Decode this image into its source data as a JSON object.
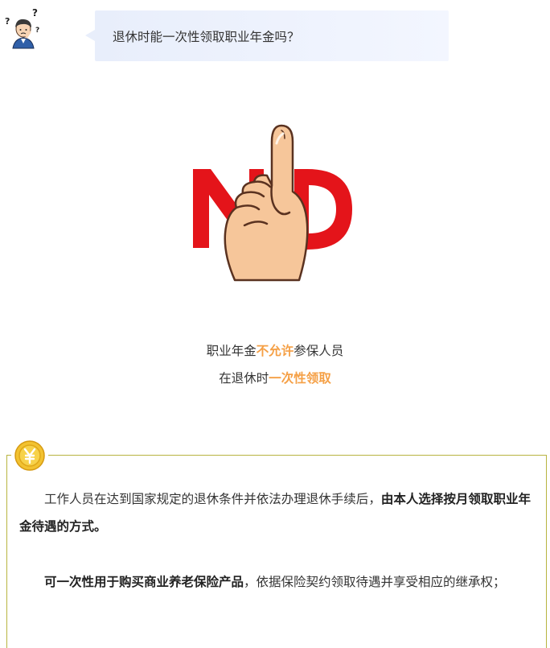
{
  "question": {
    "text": "退休时能一次性领取职业年金吗？"
  },
  "illustration": {
    "no_letters": [
      "N",
      "O"
    ],
    "colors": {
      "letters": "#e4141a",
      "skin": "#f6c69a",
      "outline": "#5a3220"
    }
  },
  "caption": {
    "line1_pre": "职业年金",
    "line1_highlight": "不允许",
    "line1_post": "参保人员",
    "line2_pre": "在退休时",
    "line2_highlight": "一次性领取",
    "highlight_color": "#f5a046"
  },
  "card": {
    "coin_icon": "yuan-coin-icon",
    "border_color": "#b8b440",
    "para1_normal": "工作人员在达到国家规定的退休条件并依法办理退休手续后，",
    "para1_bold": "由本人选择按月领取职业年金待遇的方式。",
    "para2_bold": "可一次性用于购买商业养老保险产品",
    "para2_normal": "，依据保险契约领取待遇并享受相应的继承权；"
  }
}
